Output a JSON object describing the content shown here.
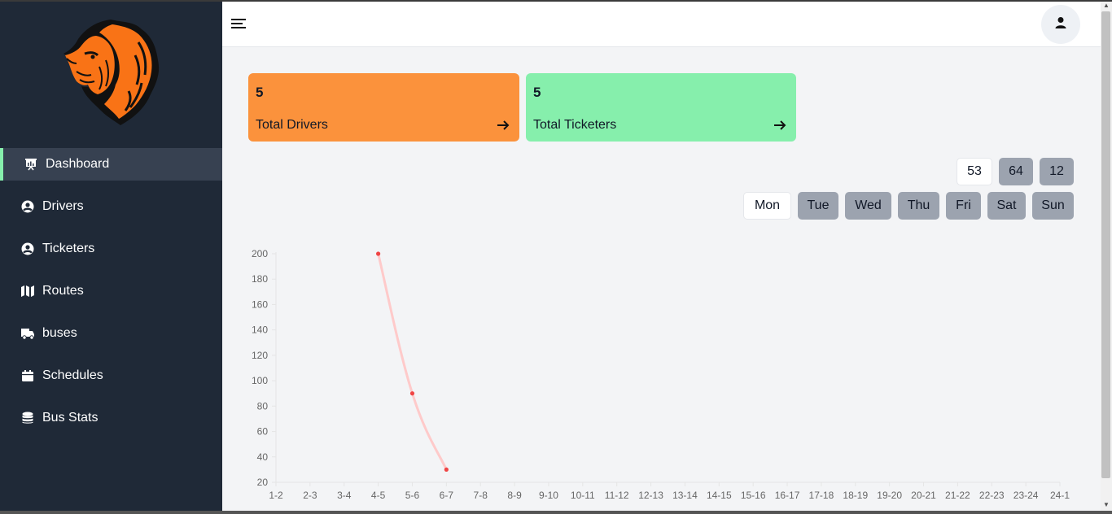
{
  "sidebar": {
    "items": [
      {
        "label": "Dashboard",
        "icon": "presentation-chart-icon"
      },
      {
        "label": "Drivers",
        "icon": "user-circle-icon"
      },
      {
        "label": "Ticketers",
        "icon": "user-circle-icon"
      },
      {
        "label": "Routes",
        "icon": "map-icon"
      },
      {
        "label": "buses",
        "icon": "truck-icon"
      },
      {
        "label": "Schedules",
        "icon": "calendar-icon"
      },
      {
        "label": "Bus Stats",
        "icon": "database-icon"
      }
    ],
    "active_item": "Dashboard",
    "accent_color": "#86efac",
    "background_color": "#1f2937"
  },
  "header": {
    "menu_icon": "hamburger-menu-icon",
    "user_icon": "user-icon"
  },
  "cards": [
    {
      "value": "5",
      "title": "Total Drivers",
      "color": "#fb923c"
    },
    {
      "value": "5",
      "title": "Total Ticketers",
      "color": "#86efac"
    }
  ],
  "filters": {
    "number_options": [
      "53",
      "64",
      "12"
    ],
    "selected_number": "53",
    "days": [
      "Mon",
      "Tue",
      "Wed",
      "Thu",
      "Fri",
      "Sat",
      "Sun"
    ],
    "selected_day": "Mon"
  },
  "chart_data": {
    "type": "line",
    "categories": [
      "1-2",
      "2-3",
      "3-4",
      "4-5",
      "5-6",
      "6-7",
      "7-8",
      "8-9",
      "9-10",
      "10-11",
      "11-12",
      "12-13",
      "13-14",
      "14-15",
      "15-16",
      "16-17",
      "17-18",
      "18-19",
      "19-20",
      "20-21",
      "21-22",
      "22-23",
      "23-24",
      "24-1"
    ],
    "series": [
      {
        "values": [
          null,
          null,
          null,
          200,
          90,
          30,
          null,
          null,
          null,
          null,
          null,
          null,
          null,
          null,
          null,
          null,
          null,
          null,
          null,
          null,
          null,
          null,
          null,
          null
        ],
        "line_color": "#fecaca",
        "point_color": "#ef4444"
      }
    ],
    "yticks": [
      "20",
      "40",
      "60",
      "80",
      "100",
      "120",
      "140",
      "160",
      "180",
      "200"
    ],
    "ylim": [
      20,
      200
    ],
    "grid": false,
    "legend": "none"
  }
}
